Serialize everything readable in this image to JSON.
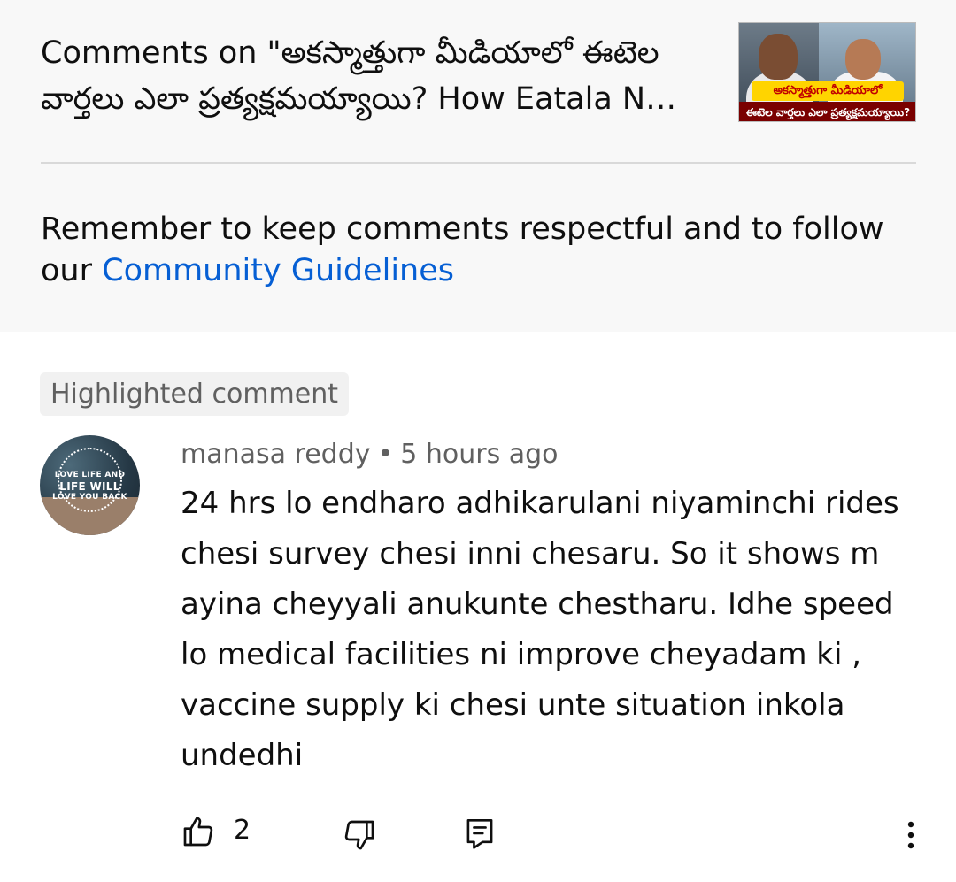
{
  "header": {
    "title": "Comments on \"అకస్మాత్తుగా మీడియాలో ఈటెల వార్తలు ఎలా ప్రత్యక్షమయ్యాయి? How Eatala N…",
    "thumbnail": {
      "headline": "అకస్మాత్తుగా మీడియాలో",
      "subline": "ఈటెల వార్తలు ఎలా ప్రత్యక్షమయ్యాయి?"
    },
    "reminder_text": "Remember to keep comments respectful and to follow our ",
    "guidelines_link": "Community Guidelines"
  },
  "comment": {
    "badge": "Highlighted comment",
    "avatar_text_1": "LOVE LIFE AND",
    "avatar_text_2": "LIFE WILL",
    "avatar_text_3": "LOVE YOU BACK",
    "author": "manasa reddy",
    "separator": "•",
    "time": "5 hours ago",
    "text": "24 hrs lo endharo adhikarulani niyaminchi rides chesi survey chesi inni chesaru. So it shows m ayina cheyyali anukunte chestharu. Idhe speed lo medical facilities ni improve cheyadam ki , vaccine supply ki chesi unte situation inkola undedhi",
    "like_count": "2"
  },
  "colors": {
    "link": "#065fd4",
    "secondary_text": "#606060",
    "header_bg": "#f8f8f8"
  },
  "icons": {
    "like": "thumb-up-icon",
    "dislike": "thumb-down-icon",
    "reply": "reply-comment-icon",
    "more": "more-vertical-icon"
  }
}
